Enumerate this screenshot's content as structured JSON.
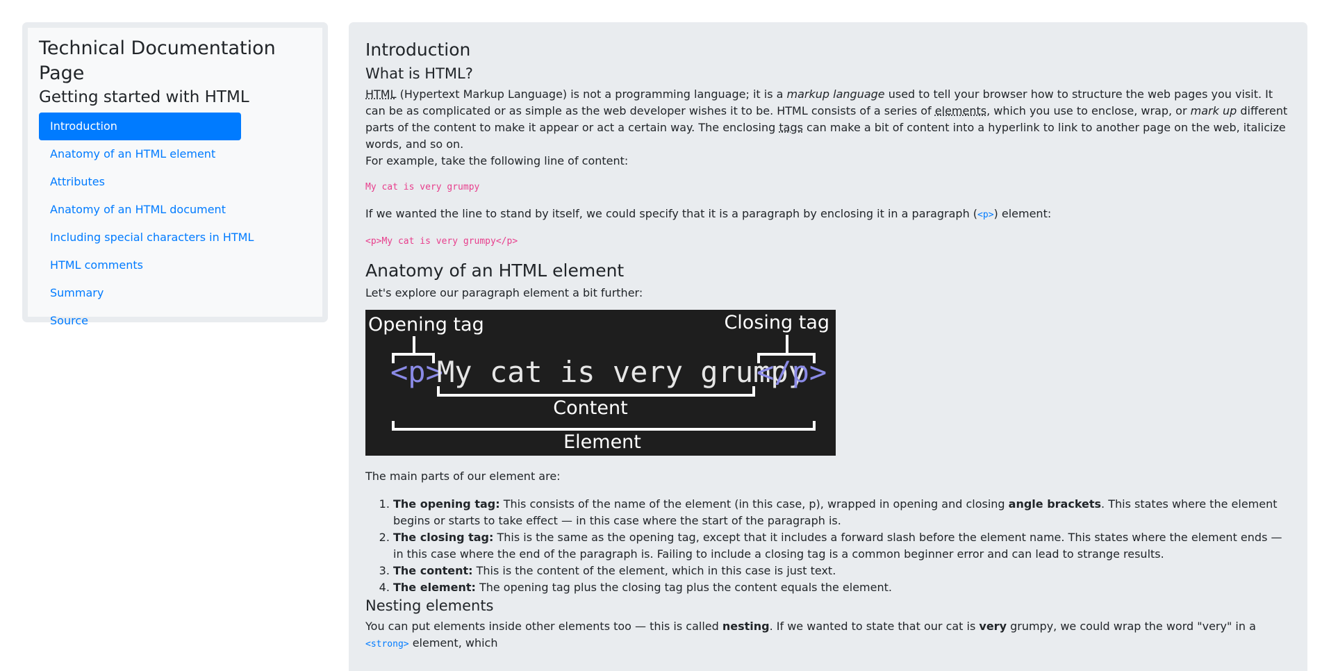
{
  "nav": {
    "title": "Technical Documentation Page",
    "subtitle": "Getting started with HTML",
    "items": [
      "Introduction",
      "Anatomy of an HTML element",
      "Attributes",
      "Anatomy of an HTML document",
      "Including special characters in HTML",
      "HTML comments",
      "Summary",
      "Source"
    ],
    "active_index": 0
  },
  "intro": {
    "heading": "Introduction",
    "subheading": "What is HTML?",
    "p1_abbr": "HTML",
    "p1_a": " (Hypertext Markup Language) is not a programming language; it is a ",
    "p1_em1": "markup language",
    "p1_b": " used to tell your browser how to structure the web pages you visit. It can be as complicated or as simple as the web developer wishes it to be. HTML consists of a series of ",
    "p1_link1": "elements",
    "p1_c": ", which you use to enclose, wrap, or ",
    "p1_em2": "mark up",
    "p1_d": " different parts of the content to make it appear or act a certain way. The enclosing ",
    "p1_link2": "tags",
    "p1_e": " can make a bit of content into a hyperlink to link to another page on the web, italicize words, and so on.",
    "p2": "For example, take the following line of content:",
    "code1": "My cat is very grumpy",
    "p3_a": "If we wanted the line to stand by itself, we could specify that it is a paragraph by enclosing it in a paragraph  (",
    "p3_code": "<p>",
    "p3_b": ") element:",
    "code2": "<p>My cat is very grumpy</p>"
  },
  "anatomy": {
    "heading": "Anatomy of an HTML element",
    "p1": "Let's explore our paragraph element a bit further:",
    "diagram": {
      "opening_tag_label": "Opening tag",
      "closing_tag_label": "Closing tag",
      "open_tag": "<p>",
      "content_text": "My cat is very grumpy",
      "close_tag": "</p>",
      "content_label": "Content",
      "element_label": "Element",
      "bg_color": "#1e1e1e",
      "tag_color": "#8a8ae6",
      "text_color": "#e6e6e6"
    },
    "p2": "The main parts of our element are:",
    "list": [
      {
        "strong": "The opening tag:",
        "text_a": " This consists of the name of the element (in this case, p), wrapped in opening and closing ",
        "strong2": "angle brackets",
        "text_b": ". This states where the element begins or starts to take effect — in this case where the start of the paragraph is."
      },
      {
        "strong": "The closing tag:",
        "text_a": " This is the same as the opening tag, except that it includes a forward slash before the element name. This states where the element ends — in this case where the end of the paragraph is. Failing to include a closing tag is a common beginner error and can lead to strange results."
      },
      {
        "strong": "The content:",
        "text_a": " This is the content of the element, which in this case is just text."
      },
      {
        "strong": "The element:",
        "text_a": " The opening tag plus the closing tag plus the content equals the element."
      }
    ]
  },
  "nesting": {
    "heading": "Nesting elements",
    "p_a": "You can put elements inside other elements too — this is called ",
    "p_strong1": "nesting",
    "p_b": ". If we wanted to state that our cat is ",
    "p_strong2": "very",
    "p_c": " grumpy, we could wrap the word \"very\" in a ",
    "p_code": "<strong>",
    "p_d": " element, which"
  },
  "colors": {
    "accent": "#007bff",
    "code_pink": "#e83e8c",
    "panel_bg": "#e9ecef",
    "nav_bg": "#f8f9fa"
  }
}
